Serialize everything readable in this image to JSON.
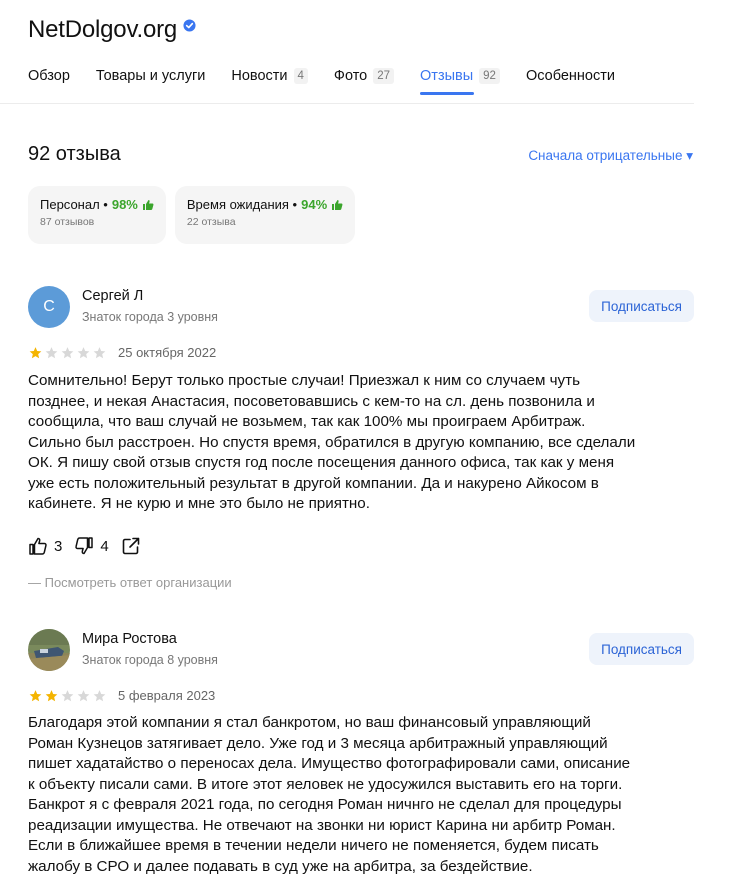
{
  "header": {
    "title": "NetDolgov.org"
  },
  "tabs": [
    {
      "label": "Обзор"
    },
    {
      "label": "Товары и услуги"
    },
    {
      "label": "Новости",
      "badge": "4"
    },
    {
      "label": "Фото",
      "badge": "27"
    },
    {
      "label": "Отзывы",
      "badge": "92"
    },
    {
      "label": "Особенности"
    }
  ],
  "summary": {
    "count_label": "92 отзыва",
    "sort_label": "Сначала отрицательные ▾"
  },
  "chips": [
    {
      "label": "Персонал •",
      "percent": "98%",
      "sub": "87 отзывов"
    },
    {
      "label": "Время ожидания •",
      "percent": "94%",
      "sub": "22 отзыва"
    }
  ],
  "reviews": [
    {
      "avatar_letter": "С",
      "name": "Сергей Л",
      "level": "Знаток города 3 уровня",
      "subscribe_label": "Подписаться",
      "rating": 1,
      "date": "25 октября 2022",
      "text_lines": [
        "Сомнительно! Берут только простые случаи! Приезжал к ним со случаем чуть",
        "позднее, и некая Анастасия, посоветовавшись с кем-то на сл. день позвонила и",
        "сообщила, что ваш случай не возьмем, так как 100% мы проиграем Арбитраж.",
        "Сильно был расстроен. Но спустя время, обратился в другую компанию, все сделали",
        "ОК. Я пишу свой отзыв спустя год после посещения данного офиса, так как у меня",
        "уже есть положительный результат в другой компании. Да и накурено Айкосом в",
        "кабинете. Я не курю и мне это было не приятно."
      ],
      "likes": "3",
      "dislikes": "4",
      "reply_label": "— Посмотреть ответ организации"
    },
    {
      "name": "Мира Ростова",
      "level": "Знаток города 8 уровня",
      "subscribe_label": "Подписаться",
      "rating": 2,
      "date": "5 февраля 2023",
      "text_lines": [
        "Благодаря этой компании я стал банкротом, но ваш финансовый управляющий",
        "Роман Кузнецов затягивает дело. Уже год и 3 месяца арбитражный управляющий",
        "пишет хадатайство о переносах дела. Имущество фотографировали сами, описание",
        "к объекту писали сами. В итоге этот яеловек не удосужился выставить его на торги.",
        "Банкрот я с февраля 2021 года, по сегодня Роман ничнго не сделал для процедуры",
        "реадизации имущества. Не отвечают на звонки ни юрист Карина ни арбитр Роман.",
        "Если в ближайшее время в течении недели ничего не поменяется, будем писать",
        "жалобу в СРО и далее подавать в суд уже на арбитра, за бездействие."
      ]
    }
  ],
  "colors": {
    "accent": "#3a76f0",
    "star_filled": "#f4b400",
    "star_empty": "#d8d8d8",
    "positive": "#3ba52c",
    "avatar_bg": "#5c9bd8"
  }
}
